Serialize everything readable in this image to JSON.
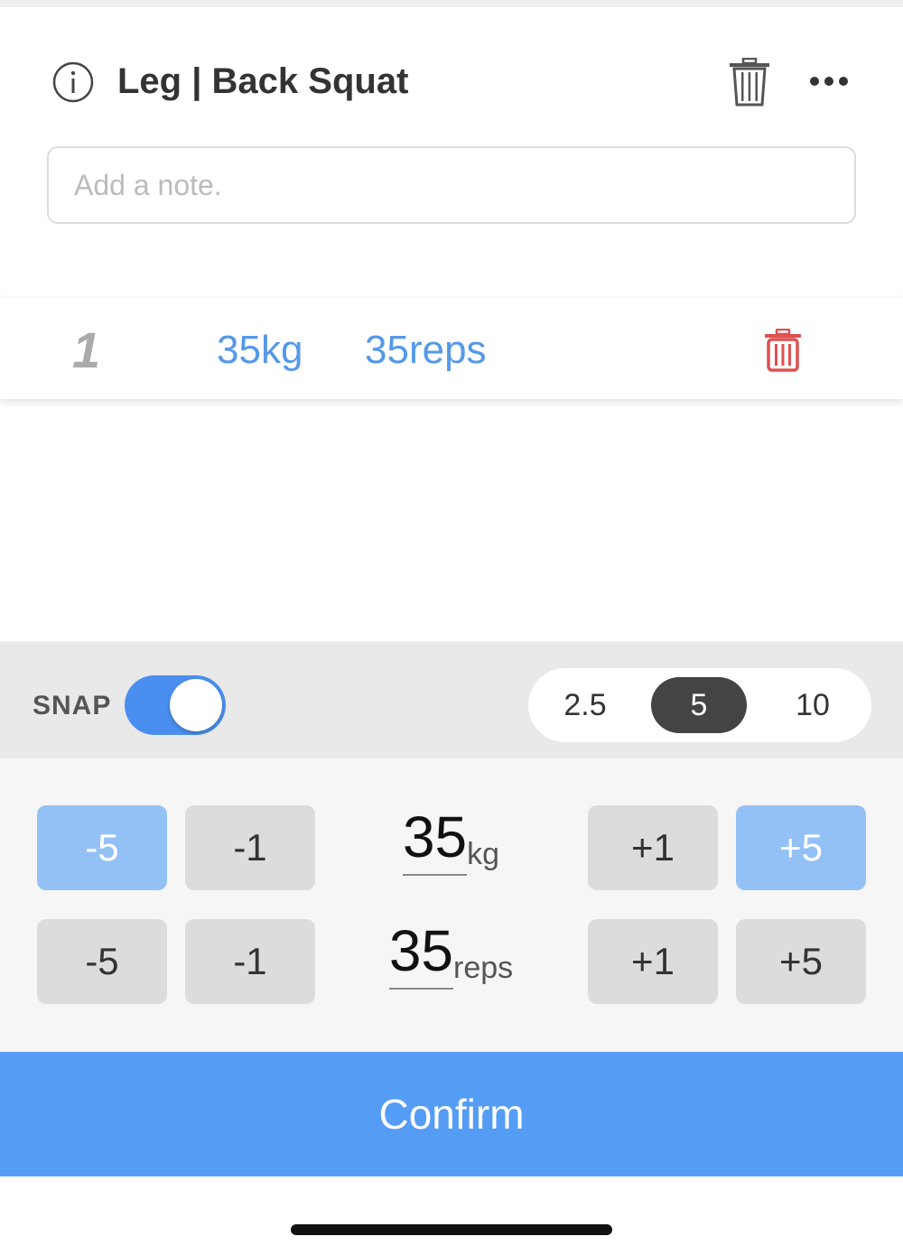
{
  "header": {
    "title": "Leg | Back Squat"
  },
  "note": {
    "placeholder": "Add a note.",
    "value": ""
  },
  "set_row": {
    "number": "1",
    "weight": "35kg",
    "reps": "35reps"
  },
  "snap": {
    "label": "SNAP",
    "enabled": true,
    "options": [
      "2.5",
      "5",
      "10"
    ],
    "selected": "5"
  },
  "weight_stepper": {
    "minus5": "-5",
    "minus1": "-1",
    "value": "35",
    "unit": "kg",
    "plus1": "+1",
    "plus5": "+5"
  },
  "reps_stepper": {
    "minus5": "-5",
    "minus1": "-1",
    "value": "35",
    "unit": "reps",
    "plus1": "+1",
    "plus5": "+5"
  },
  "confirm_label": "Confirm",
  "colors": {
    "accent": "#559cf5",
    "link": "#5598e8",
    "danger": "#e05050",
    "accent_light": "#94c1f5"
  },
  "icons": [
    "info-icon",
    "trash-icon",
    "more-icon",
    "trash-icon"
  ]
}
